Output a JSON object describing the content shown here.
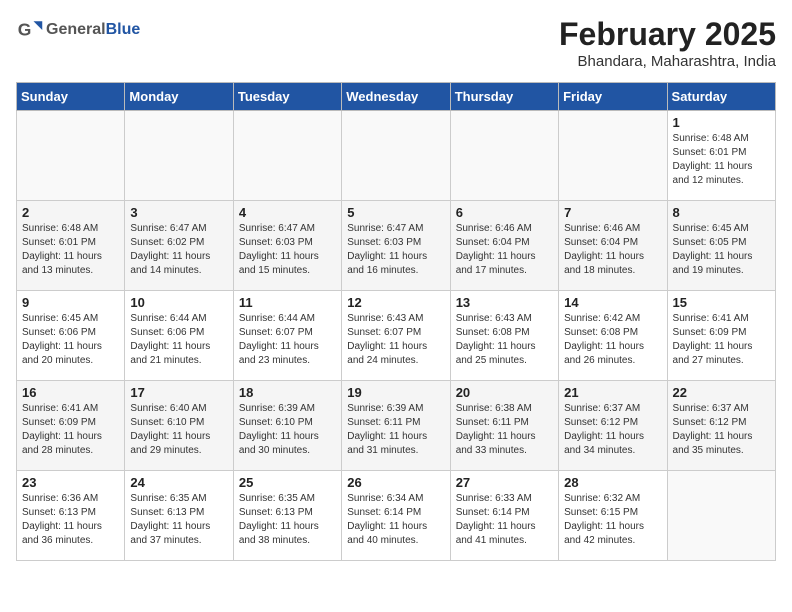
{
  "header": {
    "logo_general": "General",
    "logo_blue": "Blue",
    "month_year": "February 2025",
    "location": "Bhandara, Maharashtra, India"
  },
  "weekdays": [
    "Sunday",
    "Monday",
    "Tuesday",
    "Wednesday",
    "Thursday",
    "Friday",
    "Saturday"
  ],
  "weeks": [
    [
      {
        "day": "",
        "info": ""
      },
      {
        "day": "",
        "info": ""
      },
      {
        "day": "",
        "info": ""
      },
      {
        "day": "",
        "info": ""
      },
      {
        "day": "",
        "info": ""
      },
      {
        "day": "",
        "info": ""
      },
      {
        "day": "1",
        "info": "Sunrise: 6:48 AM\nSunset: 6:01 PM\nDaylight: 11 hours\nand 12 minutes."
      }
    ],
    [
      {
        "day": "2",
        "info": "Sunrise: 6:48 AM\nSunset: 6:01 PM\nDaylight: 11 hours\nand 13 minutes."
      },
      {
        "day": "3",
        "info": "Sunrise: 6:47 AM\nSunset: 6:02 PM\nDaylight: 11 hours\nand 14 minutes."
      },
      {
        "day": "4",
        "info": "Sunrise: 6:47 AM\nSunset: 6:03 PM\nDaylight: 11 hours\nand 15 minutes."
      },
      {
        "day": "5",
        "info": "Sunrise: 6:47 AM\nSunset: 6:03 PM\nDaylight: 11 hours\nand 16 minutes."
      },
      {
        "day": "6",
        "info": "Sunrise: 6:46 AM\nSunset: 6:04 PM\nDaylight: 11 hours\nand 17 minutes."
      },
      {
        "day": "7",
        "info": "Sunrise: 6:46 AM\nSunset: 6:04 PM\nDaylight: 11 hours\nand 18 minutes."
      },
      {
        "day": "8",
        "info": "Sunrise: 6:45 AM\nSunset: 6:05 PM\nDaylight: 11 hours\nand 19 minutes."
      }
    ],
    [
      {
        "day": "9",
        "info": "Sunrise: 6:45 AM\nSunset: 6:06 PM\nDaylight: 11 hours\nand 20 minutes."
      },
      {
        "day": "10",
        "info": "Sunrise: 6:44 AM\nSunset: 6:06 PM\nDaylight: 11 hours\nand 21 minutes."
      },
      {
        "day": "11",
        "info": "Sunrise: 6:44 AM\nSunset: 6:07 PM\nDaylight: 11 hours\nand 23 minutes."
      },
      {
        "day": "12",
        "info": "Sunrise: 6:43 AM\nSunset: 6:07 PM\nDaylight: 11 hours\nand 24 minutes."
      },
      {
        "day": "13",
        "info": "Sunrise: 6:43 AM\nSunset: 6:08 PM\nDaylight: 11 hours\nand 25 minutes."
      },
      {
        "day": "14",
        "info": "Sunrise: 6:42 AM\nSunset: 6:08 PM\nDaylight: 11 hours\nand 26 minutes."
      },
      {
        "day": "15",
        "info": "Sunrise: 6:41 AM\nSunset: 6:09 PM\nDaylight: 11 hours\nand 27 minutes."
      }
    ],
    [
      {
        "day": "16",
        "info": "Sunrise: 6:41 AM\nSunset: 6:09 PM\nDaylight: 11 hours\nand 28 minutes."
      },
      {
        "day": "17",
        "info": "Sunrise: 6:40 AM\nSunset: 6:10 PM\nDaylight: 11 hours\nand 29 minutes."
      },
      {
        "day": "18",
        "info": "Sunrise: 6:39 AM\nSunset: 6:10 PM\nDaylight: 11 hours\nand 30 minutes."
      },
      {
        "day": "19",
        "info": "Sunrise: 6:39 AM\nSunset: 6:11 PM\nDaylight: 11 hours\nand 31 minutes."
      },
      {
        "day": "20",
        "info": "Sunrise: 6:38 AM\nSunset: 6:11 PM\nDaylight: 11 hours\nand 33 minutes."
      },
      {
        "day": "21",
        "info": "Sunrise: 6:37 AM\nSunset: 6:12 PM\nDaylight: 11 hours\nand 34 minutes."
      },
      {
        "day": "22",
        "info": "Sunrise: 6:37 AM\nSunset: 6:12 PM\nDaylight: 11 hours\nand 35 minutes."
      }
    ],
    [
      {
        "day": "23",
        "info": "Sunrise: 6:36 AM\nSunset: 6:13 PM\nDaylight: 11 hours\nand 36 minutes."
      },
      {
        "day": "24",
        "info": "Sunrise: 6:35 AM\nSunset: 6:13 PM\nDaylight: 11 hours\nand 37 minutes."
      },
      {
        "day": "25",
        "info": "Sunrise: 6:35 AM\nSunset: 6:13 PM\nDaylight: 11 hours\nand 38 minutes."
      },
      {
        "day": "26",
        "info": "Sunrise: 6:34 AM\nSunset: 6:14 PM\nDaylight: 11 hours\nand 40 minutes."
      },
      {
        "day": "27",
        "info": "Sunrise: 6:33 AM\nSunset: 6:14 PM\nDaylight: 11 hours\nand 41 minutes."
      },
      {
        "day": "28",
        "info": "Sunrise: 6:32 AM\nSunset: 6:15 PM\nDaylight: 11 hours\nand 42 minutes."
      },
      {
        "day": "",
        "info": ""
      }
    ]
  ]
}
